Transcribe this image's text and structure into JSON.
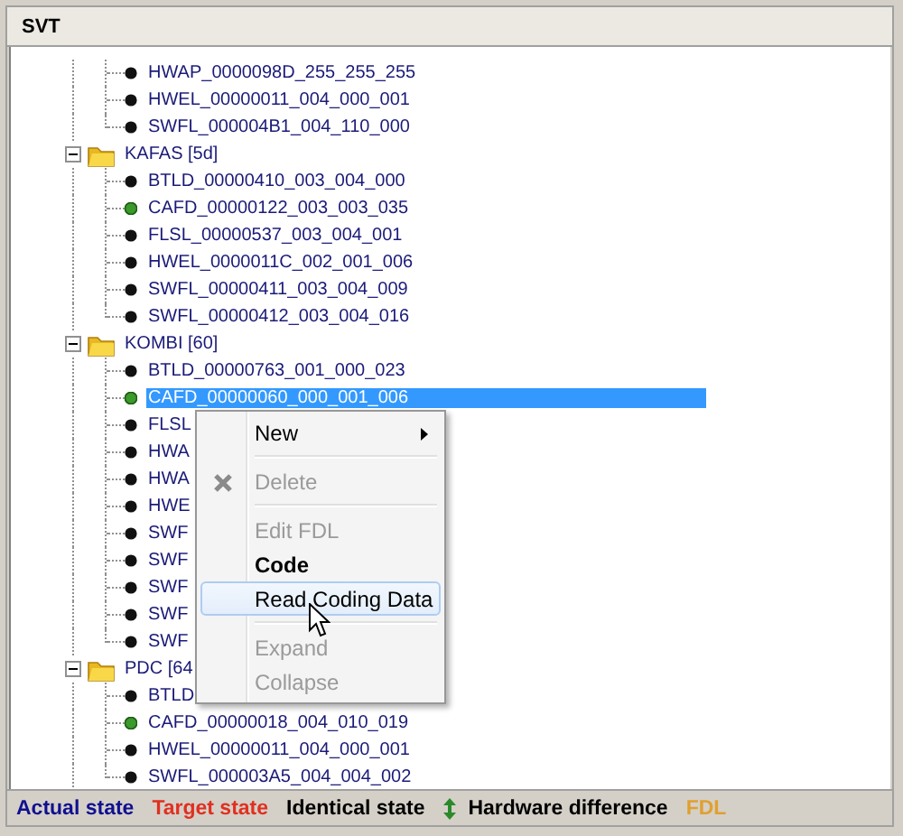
{
  "panel": {
    "title": "SVT"
  },
  "tree": [
    {
      "kind": "leaf",
      "label": "HWAP_0000098D_255_255_255",
      "hardware_difference": false,
      "selected": false
    },
    {
      "kind": "leaf",
      "label": "HWEL_00000011_004_000_001",
      "hardware_difference": false,
      "selected": false
    },
    {
      "kind": "leaf",
      "label": "SWFL_000004B1_004_110_000",
      "hardware_difference": false,
      "selected": false
    },
    {
      "kind": "folder",
      "label": "KAFAS [5d]",
      "expanded": true,
      "children": [
        {
          "kind": "leaf",
          "label": "BTLD_00000410_003_004_000",
          "hardware_difference": false,
          "selected": false
        },
        {
          "kind": "leaf",
          "label": "CAFD_00000122_003_003_035",
          "hardware_difference": true,
          "selected": false
        },
        {
          "kind": "leaf",
          "label": "FLSL_00000537_003_004_001",
          "hardware_difference": false,
          "selected": false
        },
        {
          "kind": "leaf",
          "label": "HWEL_0000011C_002_001_006",
          "hardware_difference": false,
          "selected": false
        },
        {
          "kind": "leaf",
          "label": "SWFL_00000411_003_004_009",
          "hardware_difference": false,
          "selected": false
        },
        {
          "kind": "leaf",
          "label": "SWFL_00000412_003_004_016",
          "hardware_difference": false,
          "selected": false
        }
      ]
    },
    {
      "kind": "folder",
      "label": "KOMBI [60]",
      "expanded": true,
      "children": [
        {
          "kind": "leaf",
          "label": "BTLD_00000763_001_000_023",
          "hardware_difference": false,
          "selected": false
        },
        {
          "kind": "leaf",
          "label": "CAFD_00000060_000_001_006",
          "hardware_difference": true,
          "selected": true
        },
        {
          "kind": "leaf",
          "label": "FLSL",
          "hardware_difference": false,
          "selected": false
        },
        {
          "kind": "leaf",
          "label": "HWA",
          "hardware_difference": false,
          "selected": false
        },
        {
          "kind": "leaf",
          "label": "HWA",
          "hardware_difference": false,
          "selected": false
        },
        {
          "kind": "leaf",
          "label": "HWE",
          "hardware_difference": false,
          "selected": false
        },
        {
          "kind": "leaf",
          "label": "SWF",
          "hardware_difference": false,
          "selected": false
        },
        {
          "kind": "leaf",
          "label": "SWF",
          "hardware_difference": false,
          "selected": false
        },
        {
          "kind": "leaf",
          "label": "SWF",
          "hardware_difference": false,
          "selected": false
        },
        {
          "kind": "leaf",
          "label": "SWF",
          "hardware_difference": false,
          "selected": false
        },
        {
          "kind": "leaf",
          "label": "SWF",
          "hardware_difference": false,
          "selected": false
        }
      ]
    },
    {
      "kind": "folder",
      "label": "PDC [64",
      "expanded": true,
      "children": [
        {
          "kind": "leaf",
          "label": "BTLD",
          "hardware_difference": false,
          "selected": false
        },
        {
          "kind": "leaf",
          "label": "CAFD_00000018_004_010_019",
          "hardware_difference": true,
          "selected": false
        },
        {
          "kind": "leaf",
          "label": "HWEL_00000011_004_000_001",
          "hardware_difference": false,
          "selected": false
        },
        {
          "kind": "leaf",
          "label": "SWFL_000003A5_004_004_002",
          "hardware_difference": false,
          "selected": false
        }
      ]
    }
  ],
  "context_menu": {
    "sections": [
      {
        "items": [
          {
            "label": "New",
            "kind": "submenu",
            "disabled": false,
            "hovered": false,
            "default": false
          }
        ]
      },
      {
        "items": [
          {
            "label": "Delete",
            "kind": "with_icon",
            "disabled": true,
            "hovered": false,
            "default": false
          }
        ]
      },
      {
        "items": [
          {
            "label": "Edit FDL",
            "kind": "plain",
            "disabled": true,
            "hovered": false,
            "default": false
          },
          {
            "label": "Code",
            "kind": "plain",
            "disabled": false,
            "hovered": false,
            "default": true
          },
          {
            "label": "Read Coding Data",
            "kind": "plain",
            "disabled": false,
            "hovered": true,
            "default": false
          }
        ]
      },
      {
        "items": [
          {
            "label": "Expand",
            "kind": "plain",
            "disabled": true,
            "hovered": false,
            "default": false
          },
          {
            "label": "Collapse",
            "kind": "plain",
            "disabled": true,
            "hovered": false,
            "default": false
          }
        ]
      }
    ]
  },
  "legend": [
    {
      "label": "Actual state",
      "kind": "text",
      "color": "#101090"
    },
    {
      "label": "Target state",
      "kind": "text",
      "color": "#e03020"
    },
    {
      "label": "Identical state",
      "kind": "text",
      "color": "#000000"
    },
    {
      "label": "Hardware difference",
      "kind": "icon",
      "color": "#000000"
    },
    {
      "label": "FDL",
      "kind": "text",
      "color": "#e0a030"
    }
  ]
}
